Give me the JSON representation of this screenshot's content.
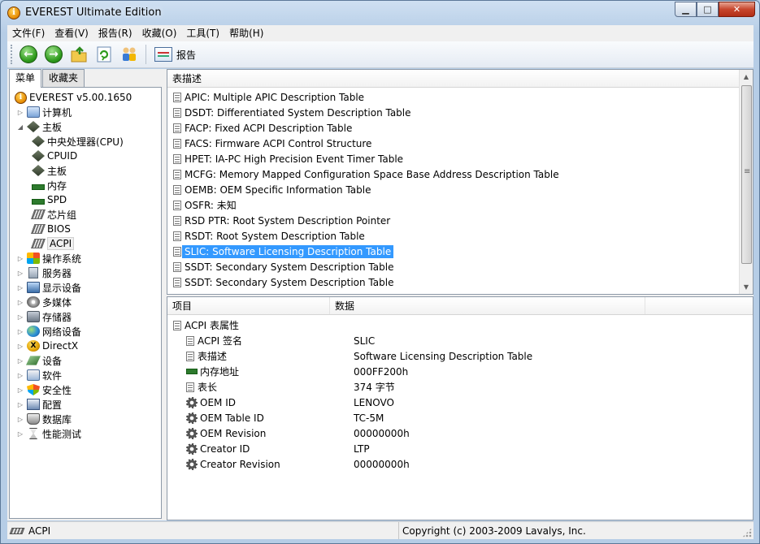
{
  "window": {
    "title": "EVEREST Ultimate Edition"
  },
  "menu": [
    "文件(F)",
    "查看(V)",
    "报告(R)",
    "收藏(O)",
    "工具(T)",
    "帮助(H)"
  ],
  "toolbar": {
    "report_label": "报告"
  },
  "left": {
    "tabs": [
      "菜单",
      "收藏夹"
    ],
    "root": "EVEREST v5.00.1650",
    "tree": [
      {
        "label": "计算机",
        "icon": "computer-icon"
      },
      {
        "label": "主板",
        "icon": "motherboard-icon"
      },
      {
        "label": "中央处理器(CPU)",
        "icon": "cpu-icon"
      },
      {
        "label": "CPUID",
        "icon": "cpuid-icon"
      },
      {
        "label": "主板",
        "icon": "motherboard-icon"
      },
      {
        "label": "内存",
        "icon": "memory-icon"
      },
      {
        "label": "SPD",
        "icon": "spd-icon"
      },
      {
        "label": "芯片组",
        "icon": "chipset-icon"
      },
      {
        "label": "BIOS",
        "icon": "bios-icon"
      },
      {
        "label": "ACPI",
        "icon": "acpi-icon"
      },
      {
        "label": "操作系统",
        "icon": "windows-icon"
      },
      {
        "label": "服务器",
        "icon": "server-icon"
      },
      {
        "label": "显示设备",
        "icon": "display-icon"
      },
      {
        "label": "多媒体",
        "icon": "multimedia-icon"
      },
      {
        "label": "存储器",
        "icon": "storage-icon"
      },
      {
        "label": "网络设备",
        "icon": "network-icon"
      },
      {
        "label": "DirectX",
        "icon": "directx-icon"
      },
      {
        "label": "设备",
        "icon": "devices-icon"
      },
      {
        "label": "软件",
        "icon": "software-icon"
      },
      {
        "label": "安全性",
        "icon": "security-icon"
      },
      {
        "label": "配置",
        "icon": "config-icon"
      },
      {
        "label": "数据库",
        "icon": "database-icon"
      },
      {
        "label": "性能测试",
        "icon": "benchmark-icon"
      }
    ]
  },
  "tables": {
    "header": "表描述",
    "items": [
      "APIC: Multiple APIC Description Table",
      "DSDT: Differentiated System Description Table",
      "FACP: Fixed ACPI Description Table",
      "FACS: Firmware ACPI Control Structure",
      "HPET: IA-PC High Precision Event Timer Table",
      "MCFG: Memory Mapped Configuration Space Base Address Description Table",
      "OEMB: OEM Specific Information Table",
      "OSFR: 未知",
      "RSD PTR: Root System Description Pointer",
      "RSDT: Root System Description Table",
      "SLIC: Software Licensing Description Table",
      "SSDT: Secondary System Description Table",
      "SSDT: Secondary System Description Table"
    ],
    "selected": "SLIC: Software Licensing Description Table"
  },
  "details": {
    "col_item": "项目",
    "col_data": "数据",
    "group": "ACPI 表属性",
    "rows": [
      {
        "label": "ACPI 签名",
        "value": "SLIC",
        "icon": "document-icon"
      },
      {
        "label": "表描述",
        "value": "Software Licensing Description Table",
        "icon": "document-icon"
      },
      {
        "label": "内存地址",
        "value": "000FF200h",
        "icon": "memory-icon"
      },
      {
        "label": "表长",
        "value": "374 字节",
        "icon": "document-icon"
      },
      {
        "label": "OEM ID",
        "value": "LENOVO",
        "icon": "gears-icon"
      },
      {
        "label": "OEM Table ID",
        "value": "TC-5M",
        "icon": "gears-icon"
      },
      {
        "label": "OEM Revision",
        "value": "00000000h",
        "icon": "gears-icon"
      },
      {
        "label": "Creator ID",
        "value": "LTP",
        "icon": "gears-icon"
      },
      {
        "label": "Creator Revision",
        "value": "00000000h",
        "icon": "gears-icon"
      }
    ]
  },
  "status": {
    "left": "ACPI",
    "right": "Copyright (c) 2003-2009 Lavalys, Inc."
  }
}
